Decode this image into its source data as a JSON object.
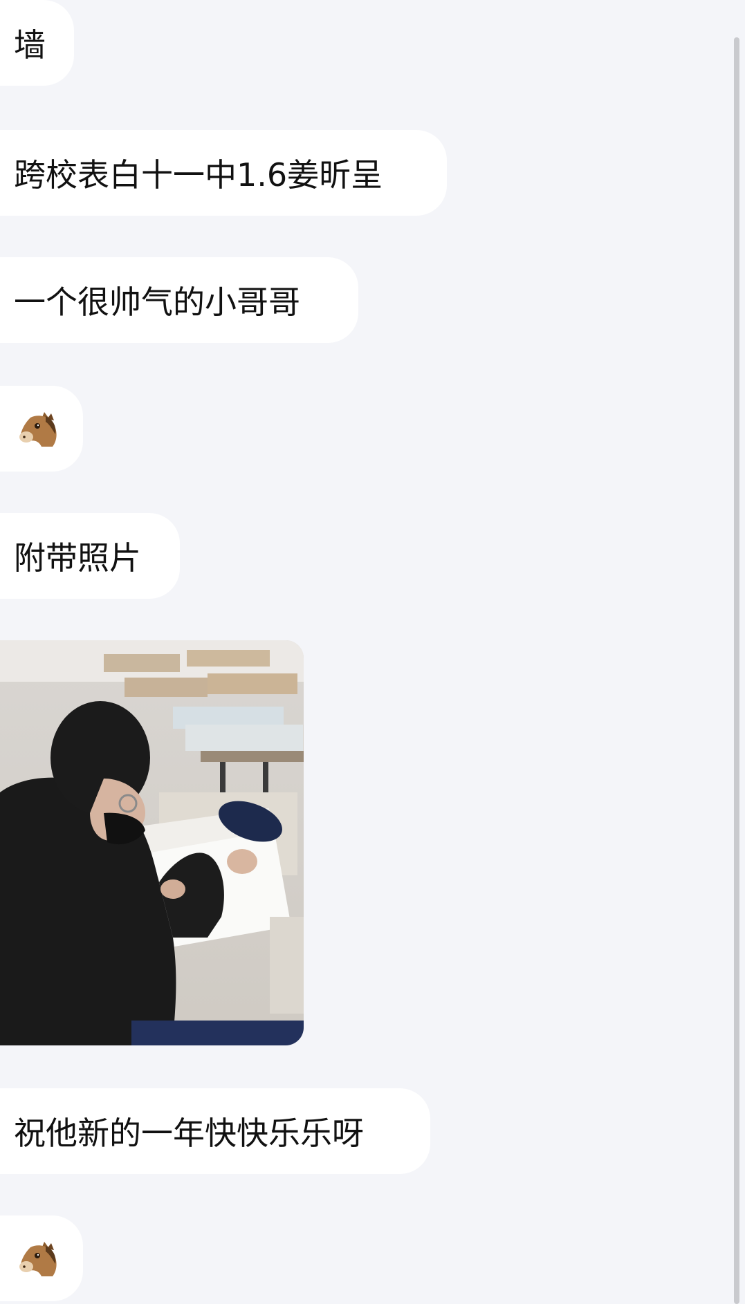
{
  "messages": [
    {
      "type": "text",
      "text": "墙"
    },
    {
      "type": "text",
      "text": "跨校表白十一中1.6姜昕呈"
    },
    {
      "type": "text",
      "text": "一个很帅气的小哥哥"
    },
    {
      "type": "emoji",
      "icon": "horse-face-icon"
    },
    {
      "type": "text",
      "text": "附带照片"
    },
    {
      "type": "image",
      "icon": "student-photo"
    },
    {
      "type": "text",
      "text": "祝他新的一年快快乐乐呀"
    },
    {
      "type": "emoji",
      "icon": "horse-face-icon"
    }
  ],
  "colors": {
    "background": "#f4f5f9",
    "bubble": "#ffffff",
    "text": "#111111",
    "scrollbar": "#c9cace"
  }
}
